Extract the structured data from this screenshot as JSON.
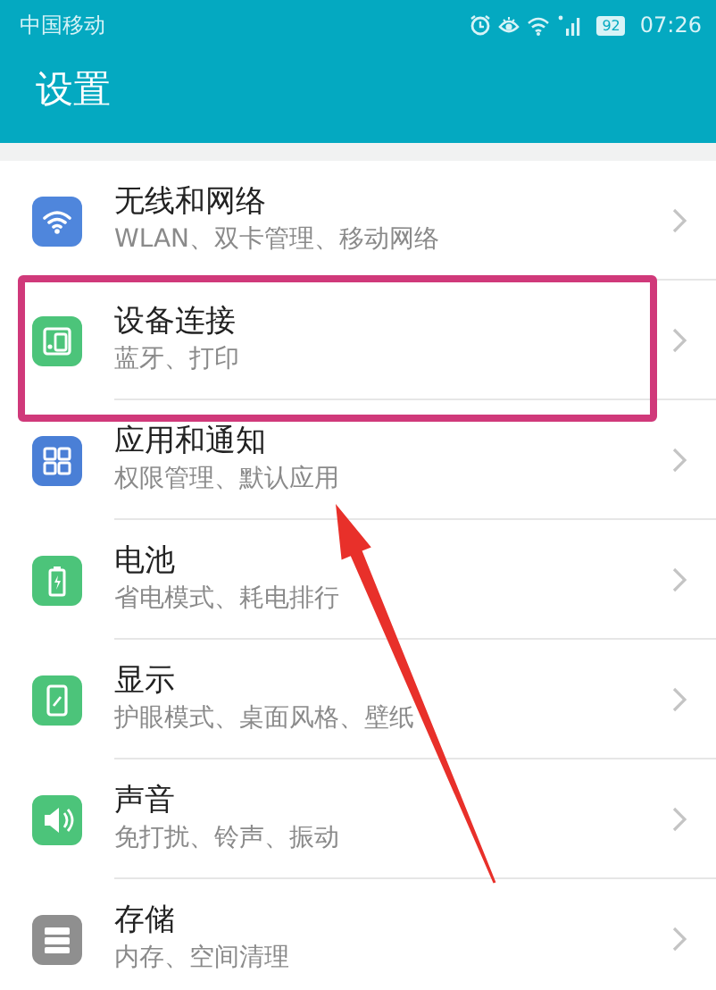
{
  "status_bar": {
    "carrier": "中国移动",
    "battery": "92",
    "time": "07:26"
  },
  "header": {
    "title": "设置"
  },
  "items": [
    {
      "kind": "wifi",
      "title": "无线和网络",
      "subtitle": "WLAN、双卡管理、移动网络",
      "color": "#4f86dc",
      "highlighted": false
    },
    {
      "kind": "devices",
      "title": "设备连接",
      "subtitle": "蓝牙、打印",
      "color": "#4cc47a",
      "highlighted": true
    },
    {
      "kind": "apps",
      "title": "应用和通知",
      "subtitle": "权限管理、默认应用",
      "color": "#4a7fd6",
      "highlighted": false
    },
    {
      "kind": "battery",
      "title": "电池",
      "subtitle": "省电模式、耗电排行",
      "color": "#4cc47a",
      "highlighted": false
    },
    {
      "kind": "display",
      "title": "显示",
      "subtitle": "护眼模式、桌面风格、壁纸",
      "color": "#4cc47a",
      "highlighted": false
    },
    {
      "kind": "sound",
      "title": "声音",
      "subtitle": "免打扰、铃声、振动",
      "color": "#4cc47a",
      "highlighted": false
    },
    {
      "kind": "storage",
      "title": "存储",
      "subtitle": "内存、空间清理",
      "color": "#8f8f8f",
      "highlighted": false
    }
  ]
}
